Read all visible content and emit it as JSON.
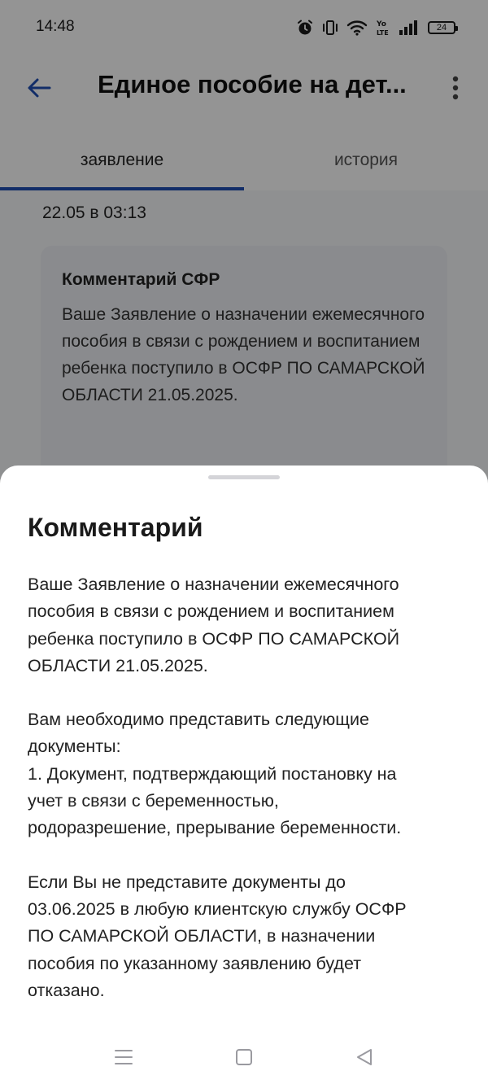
{
  "status_bar": {
    "time": "14:48",
    "battery": "24",
    "icons": [
      "alarm-icon",
      "vibrate-icon",
      "wifi-icon",
      "volte-icon",
      "signal-icon",
      "battery-icon"
    ]
  },
  "header": {
    "title": "Единое пособие на дет..."
  },
  "tabs": [
    {
      "label": "заявление",
      "active": true
    },
    {
      "label": "история",
      "active": false
    }
  ],
  "background_content": {
    "date": "22.05 в 03:13",
    "card_title": "Комментарий СФР",
    "card_text": "Ваше Заявление о назначении ежемесячного пособия в связи с рождением и воспитанием ребенка поступило в ОСФР ПО САМАРСКОЙ ОБЛАСТИ 21.05.2025."
  },
  "sheet": {
    "title": "Комментарий",
    "paragraphs": [
      [
        "Ваше Заявление о назначении ежемесячного",
        "пособия в связи с рождением и воспитанием",
        "ребенка поступило в ОСФР ПО САМАРСКОЙ",
        "ОБЛАСТИ 21.05.2025."
      ],
      [
        "Вам необходимо представить следующие",
        "документы:",
        "1. Документ, подтверждающий постановку на",
        "учет в связи с беременностью,",
        "родоразрешение, прерывание беременности."
      ],
      [
        "Если Вы не представите документы до",
        "03.06.2025 в любую клиентскую службу ОСФР",
        "ПО САМАРСКОЙ ОБЛАСТИ, в назначении",
        "пособия по указанному заявлению будет",
        "отказано."
      ]
    ]
  },
  "colors": {
    "accent": "#1f4fb3",
    "scrim": "rgba(0,0,0,0.42)",
    "card_bg": "#eef0f4"
  }
}
